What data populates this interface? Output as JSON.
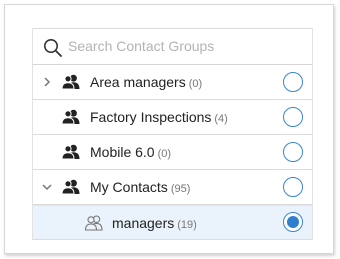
{
  "search": {
    "placeholder": "Search Contact Groups"
  },
  "groups": [
    {
      "name": "Area managers",
      "count": "(0)"
    },
    {
      "name": "Factory Inspections",
      "count": "(4)"
    },
    {
      "name": "Mobile 6.0",
      "count": "(0)"
    },
    {
      "name": "My Contacts",
      "count": "(95)"
    },
    {
      "name": "managers",
      "count": "(19)"
    }
  ],
  "colors": {
    "accent": "#2f7fcf",
    "selected_row": "#eaf3fb"
  }
}
